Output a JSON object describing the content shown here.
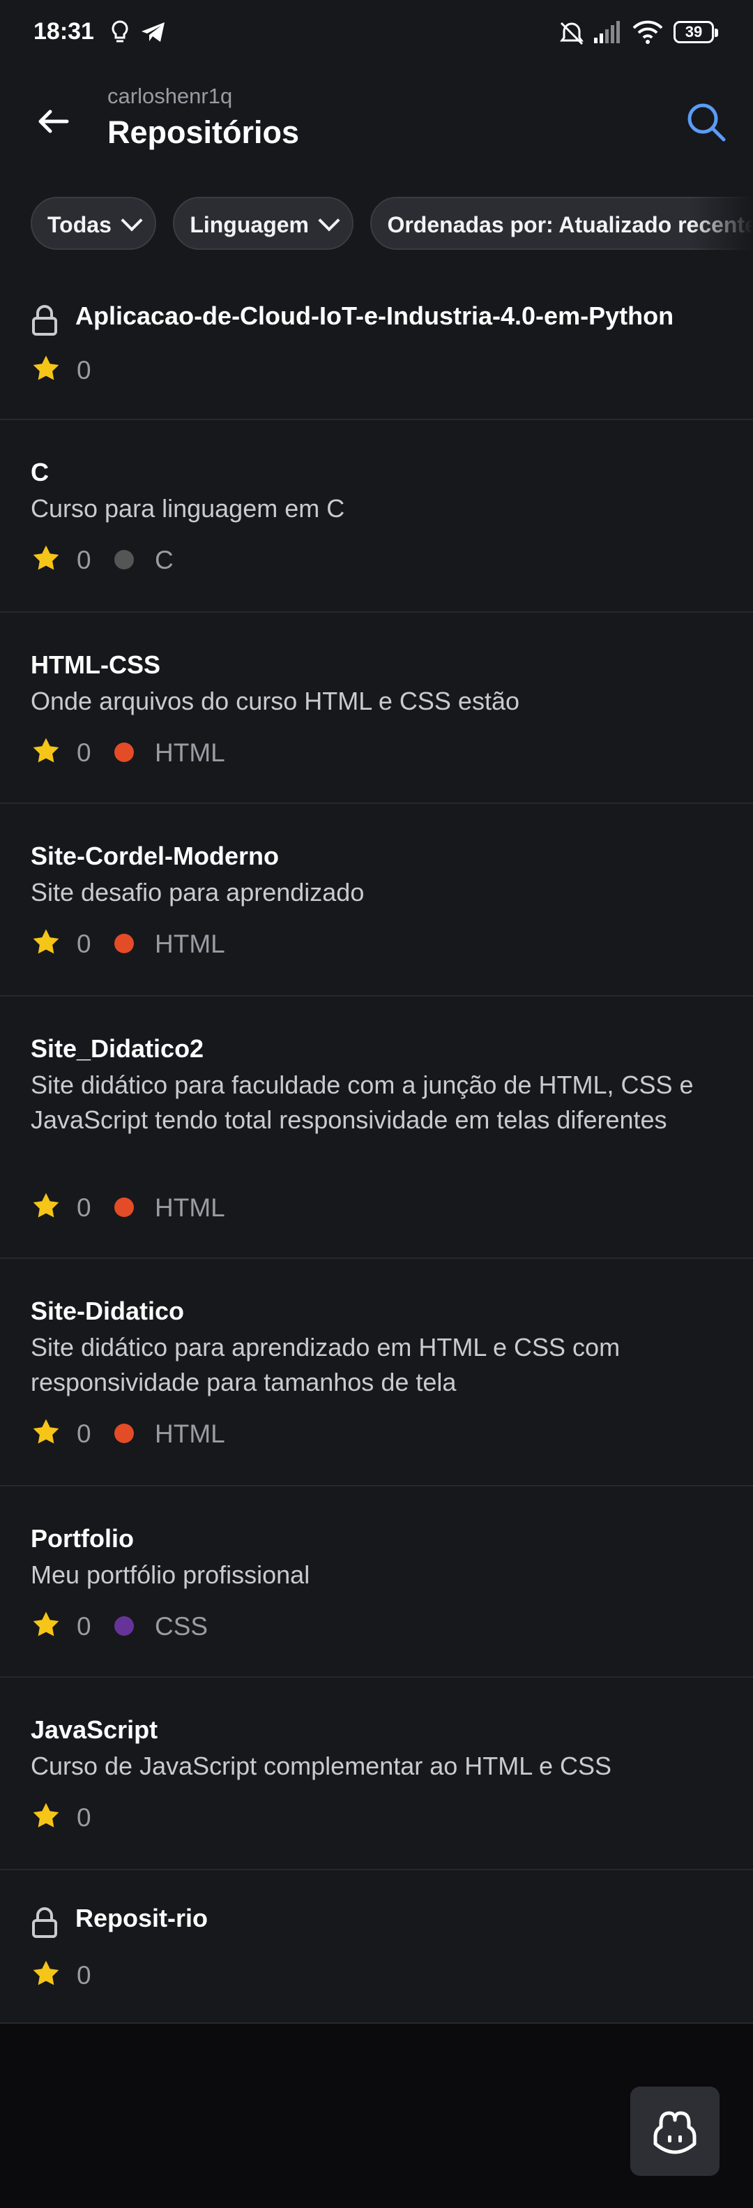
{
  "status_bar": {
    "time": "18:31",
    "battery": "39"
  },
  "header": {
    "owner": "carloshenr1q",
    "title": "Repositórios"
  },
  "filters": [
    {
      "label": "Todas"
    },
    {
      "label": "Linguagem"
    },
    {
      "label": "Ordenadas por: Atualizado recentemente"
    }
  ],
  "colors": {
    "star": "#f5c518",
    "C": "#555555",
    "HTML": "#e34c26",
    "CSS": "#663399",
    "accent": "#5b9cf5"
  },
  "repos": [
    {
      "name": "Aplicacao-de-Cloud-IoT-e-Industria-4.0-em-Python",
      "private": true,
      "stars": "0"
    },
    {
      "name": "C",
      "description": "Curso para linguagem em C",
      "stars": "0",
      "language": "C"
    },
    {
      "name": "HTML-CSS",
      "description": "Onde arquivos do curso HTML e CSS estão",
      "stars": "0",
      "language": "HTML"
    },
    {
      "name": "Site-Cordel-Moderno",
      "description": "Site desafio para aprendizado",
      "stars": "0",
      "language": "HTML"
    },
    {
      "name": "Site_Didatico2",
      "description": "Site didático para faculdade com a junção de HTML, CSS e JavaScript tendo total responsividade em telas diferentes",
      "stars": "0",
      "language": "HTML"
    },
    {
      "name": "Site-Didatico",
      "description": "Site didático para aprendizado em HTML e CSS com responsividade para tamanhos de tela",
      "stars": "0",
      "language": "HTML"
    },
    {
      "name": "Portfolio",
      "description": "Meu portfólio profissional",
      "stars": "0",
      "language": "CSS"
    },
    {
      "name": "JavaScript",
      "description": "Curso de JavaScript complementar ao HTML e CSS",
      "stars": "0"
    },
    {
      "name": "Reposit-rio",
      "private": true,
      "stars": "0"
    }
  ]
}
